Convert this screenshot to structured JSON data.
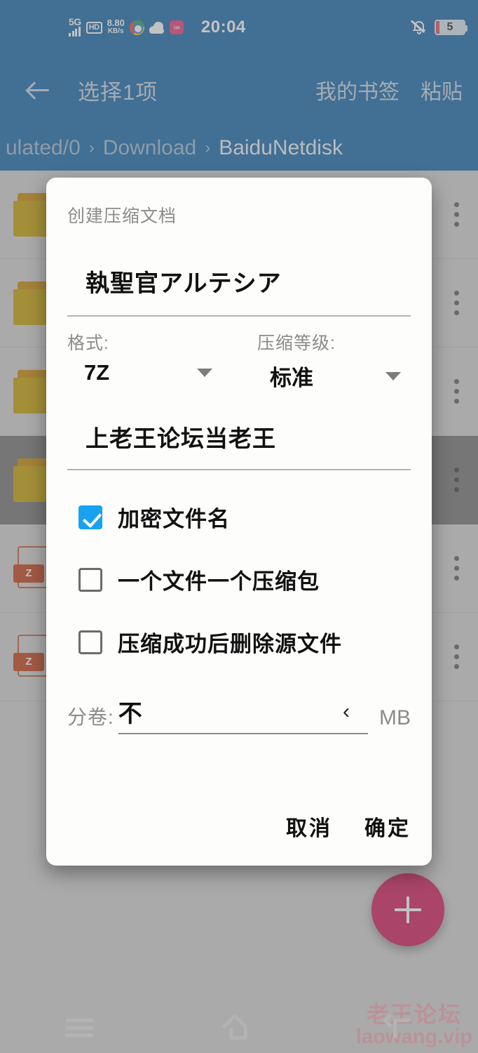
{
  "statusbar": {
    "network_label": "5G",
    "hd_label": "HD",
    "speed_value": "8.80",
    "speed_unit": "KB/s",
    "chrome_icon": "chrome-icon",
    "cloud_icon": "cloud-icon",
    "app_icon_label": "bilibili",
    "time": "20:04",
    "mute_icon": "bell-off-icon",
    "battery_level": "5"
  },
  "toolbar": {
    "back_icon": "back-arrow-icon",
    "title": "选择1项",
    "actions": [
      {
        "label": "我的书签"
      },
      {
        "label": "粘贴"
      }
    ]
  },
  "breadcrumb": {
    "items": [
      {
        "label": "ulated/0",
        "current": false
      },
      {
        "label": "Download",
        "current": false
      },
      {
        "label": "BaiduNetdisk",
        "current": true
      }
    ],
    "separator": "›"
  },
  "filelist": {
    "rows": [
      {
        "icon": "folder-icon",
        "selected": false
      },
      {
        "icon": "folder-icon",
        "selected": false
      },
      {
        "icon": "folder-icon",
        "selected": false
      },
      {
        "icon": "folder-icon",
        "selected": true
      },
      {
        "icon": "zip-file-icon",
        "badge": "Z",
        "selected": false
      },
      {
        "icon": "zip-file-icon",
        "badge": "Z",
        "selected": false
      }
    ],
    "overflow_icon": "more-vertical-icon"
  },
  "fab": {
    "icon": "plus-icon"
  },
  "watermark": {
    "line1": "老王论坛",
    "line2": "laowang.vip",
    "color": "#f2a8b5"
  },
  "navbar": {
    "recents_icon": "recents-icon",
    "home_icon": "home-icon",
    "back_icon": "back-icon"
  },
  "dialog": {
    "title": "创建压缩文档",
    "archive_name": "執聖官アルテシア",
    "format": {
      "label": "格式:",
      "value": "7Z",
      "caret_icon": "chevron-down-icon"
    },
    "level": {
      "label": "压缩等级:",
      "value": "标准",
      "caret_icon": "chevron-down-icon"
    },
    "password": "上老王论坛当老王",
    "checkboxes": [
      {
        "label": "加密文件名",
        "checked": true
      },
      {
        "label": "一个文件一个压缩包",
        "checked": false
      },
      {
        "label": "压缩成功后删除源文件",
        "checked": false
      }
    ],
    "split": {
      "label": "分卷:",
      "value": "不",
      "chevron_icon": "chevron-left-icon",
      "chevron_glyph": "‹",
      "unit": "MB"
    },
    "buttons": {
      "cancel": "取消",
      "confirm": "确定"
    },
    "accent_color": "#18a2f0"
  }
}
